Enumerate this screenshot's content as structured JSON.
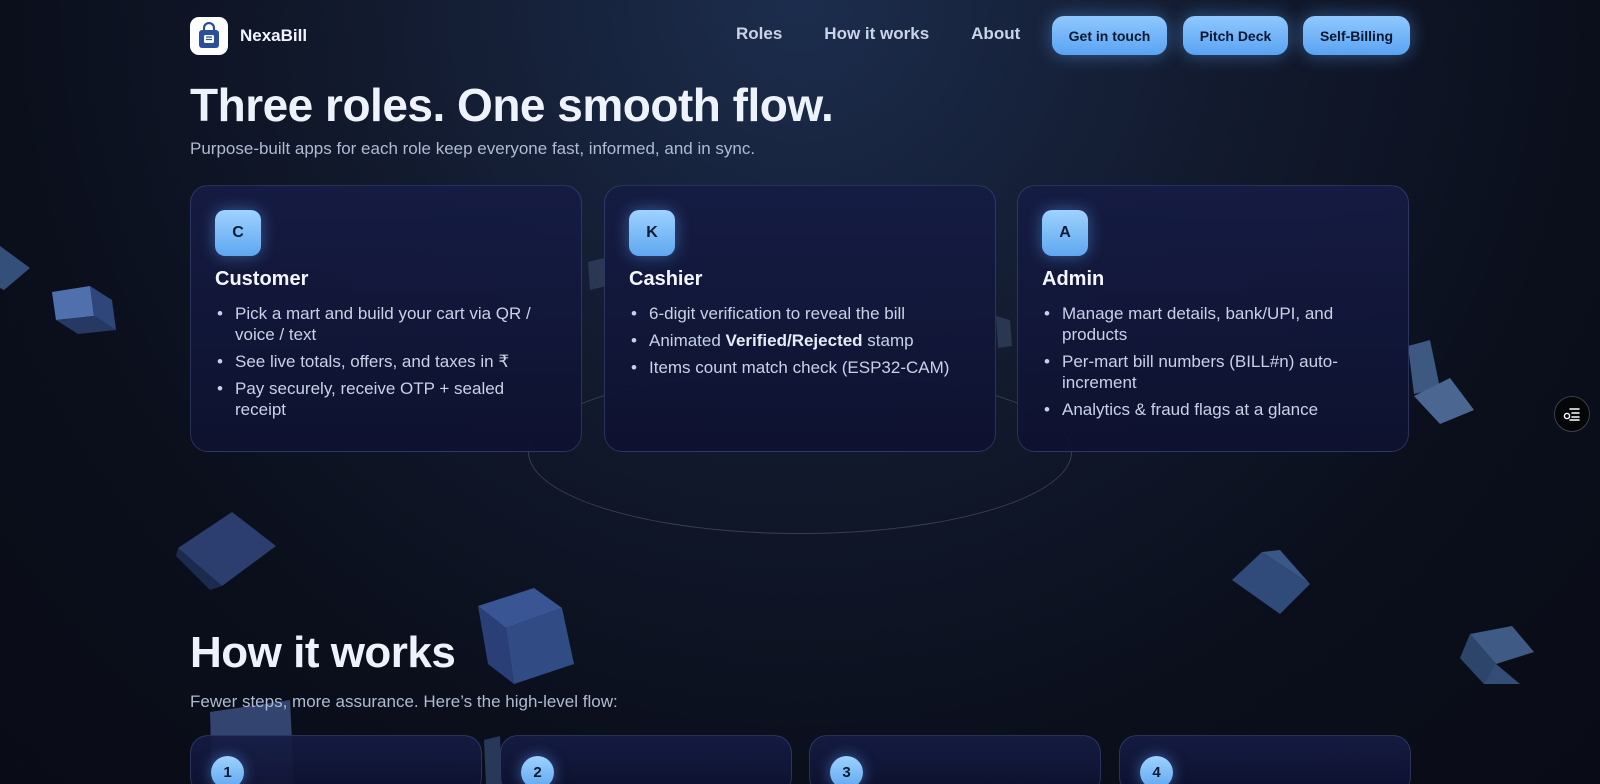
{
  "brand": {
    "name": "NexaBill"
  },
  "nav": {
    "links": [
      "Roles",
      "How it works",
      "About"
    ],
    "buttons": [
      "Get in touch",
      "Pitch Deck",
      "Self-Billing"
    ]
  },
  "roles": {
    "title": "Three roles. One smooth flow.",
    "subtitle": "Purpose-built apps for each role keep everyone fast, informed, and in sync.",
    "cards": [
      {
        "badge": "C",
        "title": "Customer",
        "items": [
          "Pick a mart and build your cart via QR / voice / text",
          "See live totals, offers, and taxes in ₹",
          "Pay securely, receive OTP + sealed receipt"
        ]
      },
      {
        "badge": "K",
        "title": "Cashier",
        "items": [
          "6-digit verification to reveal the bill",
          {
            "pre": "Animated ",
            "b1": "Verified",
            "mid": "/",
            "b2": "Rejected",
            "post": " stamp"
          },
          "Items count match check (ESP32-CAM)"
        ]
      },
      {
        "badge": "A",
        "title": "Admin",
        "items": [
          "Manage mart details, bank/UPI, and products",
          "Per-mart bill numbers (BILL#n) auto-increment",
          "Analytics & fraud flags at a glance"
        ]
      }
    ]
  },
  "how": {
    "title": "How it works",
    "subtitle": "Fewer steps, more assurance. Here’s the high-level flow:",
    "steps": [
      "1",
      "2",
      "3",
      "4"
    ]
  },
  "icons": {
    "logo": "shopping-bag-icon",
    "fab": "toc-list-icon"
  },
  "colors": {
    "accent": "#6fb4f7",
    "background": "#0b0f1c",
    "card": "#151b44"
  }
}
